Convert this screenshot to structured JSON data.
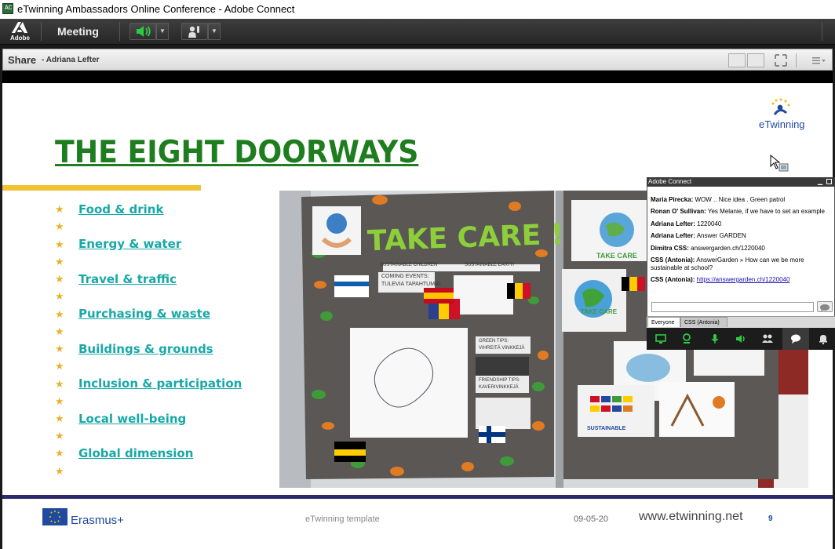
{
  "window": {
    "title": "eTwinning Ambassadors Online Conference - Adobe Connect",
    "app_icon_text": "AC"
  },
  "menubar": {
    "brand": "Adobe",
    "meeting_label": "Meeting"
  },
  "pod": {
    "title": "Share",
    "presenter": "- Adriana Lefter"
  },
  "slide": {
    "title": "THE EIGHT DOORWAYS",
    "logo_text": "eTwinning",
    "doorways": [
      "Food & drink",
      "Energy & water",
      "Travel & traffic",
      "Purchasing & waste",
      "Buildings & grounds",
      "Inclusion & participation",
      "Local well-being",
      "Global dimension"
    ],
    "bullet_glyph": "★",
    "footer": {
      "erasmus": "Erasmus+",
      "template": "eTwinning template",
      "date": "09-05-20",
      "url": "www.etwinning.net",
      "page": "9"
    },
    "photo": {
      "board_heading": "TAKE CARE !",
      "tags": [
        "SUSTAINABLE CHILDREN",
        "SUSTAINABLE EARTH"
      ],
      "poster_lines": [
        "COMING EVENTS:",
        "TULEVIA TAPAHTUMIA:"
      ],
      "green_tips": "GREEN TIPS:",
      "green_tips_sub": "VIHREITÄ VINKKEJÄ",
      "friendship_tips": "FRIENDSHIP TIPS:",
      "friendship_tips_sub": "KAVERIVINKKEJÄ",
      "right_drawing": "TAKE CARE",
      "right_drawing_2": "TAKE CARE",
      "sustainable_label": "SUSTAINABLE"
    }
  },
  "chat": {
    "title": "Adobe Connect",
    "messages": [
      {
        "author": "Maria Pirecka:",
        "text": "WOW .. Nice idea . Green patrol"
      },
      {
        "author": "Ronan O' Sullivan:",
        "text": "Yes Melanie, if we have to set an example"
      },
      {
        "author": "Adriana Lefter:",
        "text": "1220040"
      },
      {
        "author": "Adriana Lefter:",
        "text": "Answer GARDEN"
      },
      {
        "author": "Dimitra CSS:",
        "text": "answergarden.ch/1220040"
      },
      {
        "author": "CSS (Antonia):",
        "text": "AnswerGarden » How can we be more sustainable at school?"
      },
      {
        "author": "CSS (Antonia):",
        "text": "https://answergarden.ch/1220040",
        "link": true
      }
    ],
    "input_value": "",
    "tabs": [
      "Everyone",
      "CSS (Antonia)"
    ],
    "active_tab": "Everyone",
    "toolbar_icons": [
      "camera-icon",
      "webcam-icon",
      "microphone-icon",
      "speaker-icon",
      "attendees-icon",
      "chat-icon",
      "notification-icon"
    ]
  },
  "colors": {
    "accent_green": "#1e7d1e",
    "link_teal": "#18a8a8",
    "rule_yellow": "#f1c232",
    "footer_navy": "#2b2a6e",
    "icon_green": "#2ecc40"
  }
}
